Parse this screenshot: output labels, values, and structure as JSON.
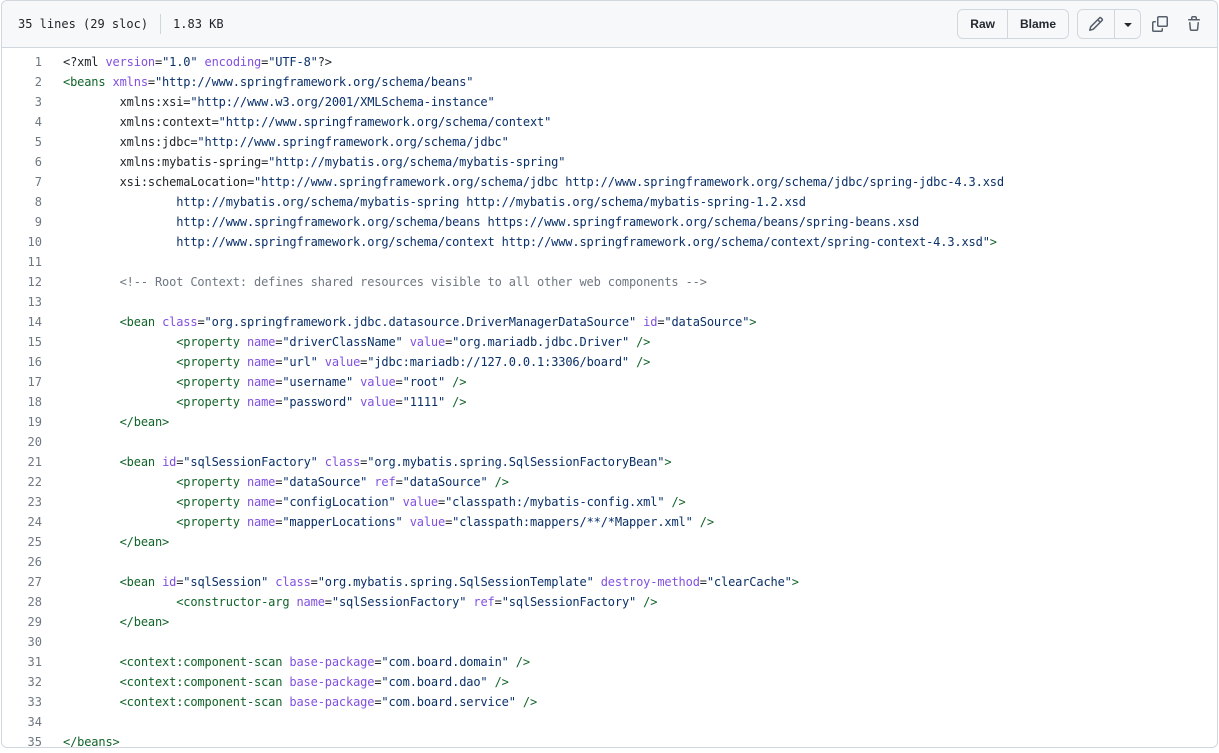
{
  "header": {
    "lines_info": "35 lines (29 sloc)",
    "size_info": "1.83 KB",
    "raw_label": "Raw",
    "blame_label": "Blame"
  },
  "colors": {
    "tag": "#116329",
    "attr": "#8250df",
    "string": "#0a3069",
    "comment": "#6e7781"
  },
  "icons": [
    "pencil-icon",
    "triangle-down-icon",
    "copy-icon",
    "trash-icon"
  ],
  "code_lines": [
    [
      [
        "pi",
        "<?xml "
      ],
      [
        "attr",
        "version"
      ],
      [
        "pi",
        "="
      ],
      [
        "str",
        "\"1.0\""
      ],
      [
        "pi",
        " "
      ],
      [
        "attr",
        "encoding"
      ],
      [
        "pi",
        "="
      ],
      [
        "str",
        "\"UTF-8\""
      ],
      [
        "pi",
        "?>"
      ]
    ],
    [
      [
        "tag",
        "<beans "
      ],
      [
        "attr",
        "xmlns"
      ],
      [
        "pi",
        "="
      ],
      [
        "str",
        "\"http://www.springframework.org/schema/beans\""
      ]
    ],
    [
      [
        "pi",
        "        xmlns:xsi="
      ],
      [
        "str",
        "\"http://www.w3.org/2001/XMLSchema-instance\""
      ]
    ],
    [
      [
        "pi",
        "        xmlns:context="
      ],
      [
        "str",
        "\"http://www.springframework.org/schema/context\""
      ]
    ],
    [
      [
        "pi",
        "        xmlns:jdbc="
      ],
      [
        "str",
        "\"http://www.springframework.org/schema/jdbc\""
      ]
    ],
    [
      [
        "pi",
        "        xmlns:mybatis-spring="
      ],
      [
        "str",
        "\"http://mybatis.org/schema/mybatis-spring\""
      ]
    ],
    [
      [
        "pi",
        "        xsi:schemaLocation="
      ],
      [
        "str",
        "\"http://www.springframework.org/schema/jdbc http://www.springframework.org/schema/jdbc/spring-jdbc-4.3.xsd"
      ]
    ],
    [
      [
        "str",
        "                http://mybatis.org/schema/mybatis-spring http://mybatis.org/schema/mybatis-spring-1.2.xsd"
      ]
    ],
    [
      [
        "str",
        "                http://www.springframework.org/schema/beans https://www.springframework.org/schema/beans/spring-beans.xsd"
      ]
    ],
    [
      [
        "str",
        "                http://www.springframework.org/schema/context http://www.springframework.org/schema/context/spring-context-4.3.xsd\""
      ],
      [
        "tag",
        ">"
      ]
    ],
    [],
    [
      [
        "pi",
        "        "
      ],
      [
        "com",
        "<!-- Root Context: defines shared resources visible to all other web components -->"
      ]
    ],
    [],
    [
      [
        "pi",
        "        "
      ],
      [
        "tag",
        "<bean "
      ],
      [
        "attr",
        "class"
      ],
      [
        "pi",
        "="
      ],
      [
        "str",
        "\"org.springframework.jdbc.datasource.DriverManagerDataSource\""
      ],
      [
        "pi",
        " "
      ],
      [
        "attr",
        "id"
      ],
      [
        "pi",
        "="
      ],
      [
        "str",
        "\"dataSource\""
      ],
      [
        "tag",
        ">"
      ]
    ],
    [
      [
        "pi",
        "                "
      ],
      [
        "tag",
        "<property "
      ],
      [
        "attr",
        "name"
      ],
      [
        "pi",
        "="
      ],
      [
        "str",
        "\"driverClassName\""
      ],
      [
        "pi",
        " "
      ],
      [
        "attr",
        "value"
      ],
      [
        "pi",
        "="
      ],
      [
        "str",
        "\"org.mariadb.jdbc.Driver\""
      ],
      [
        "tag",
        " />"
      ]
    ],
    [
      [
        "pi",
        "                "
      ],
      [
        "tag",
        "<property "
      ],
      [
        "attr",
        "name"
      ],
      [
        "pi",
        "="
      ],
      [
        "str",
        "\"url\""
      ],
      [
        "pi",
        " "
      ],
      [
        "attr",
        "value"
      ],
      [
        "pi",
        "="
      ],
      [
        "str",
        "\"jdbc:mariadb://127.0.0.1:3306/board\""
      ],
      [
        "tag",
        " />"
      ]
    ],
    [
      [
        "pi",
        "                "
      ],
      [
        "tag",
        "<property "
      ],
      [
        "attr",
        "name"
      ],
      [
        "pi",
        "="
      ],
      [
        "str",
        "\"username\""
      ],
      [
        "pi",
        " "
      ],
      [
        "attr",
        "value"
      ],
      [
        "pi",
        "="
      ],
      [
        "str",
        "\"root\""
      ],
      [
        "tag",
        " />"
      ]
    ],
    [
      [
        "pi",
        "                "
      ],
      [
        "tag",
        "<property "
      ],
      [
        "attr",
        "name"
      ],
      [
        "pi",
        "="
      ],
      [
        "str",
        "\"password\""
      ],
      [
        "pi",
        " "
      ],
      [
        "attr",
        "value"
      ],
      [
        "pi",
        "="
      ],
      [
        "str",
        "\"1111\""
      ],
      [
        "tag",
        " />"
      ]
    ],
    [
      [
        "pi",
        "        "
      ],
      [
        "tag",
        "</bean>"
      ]
    ],
    [],
    [
      [
        "pi",
        "        "
      ],
      [
        "tag",
        "<bean "
      ],
      [
        "attr",
        "id"
      ],
      [
        "pi",
        "="
      ],
      [
        "str",
        "\"sqlSessionFactory\""
      ],
      [
        "pi",
        " "
      ],
      [
        "attr",
        "class"
      ],
      [
        "pi",
        "="
      ],
      [
        "str",
        "\"org.mybatis.spring.SqlSessionFactoryBean\""
      ],
      [
        "tag",
        ">"
      ]
    ],
    [
      [
        "pi",
        "                "
      ],
      [
        "tag",
        "<property "
      ],
      [
        "attr",
        "name"
      ],
      [
        "pi",
        "="
      ],
      [
        "str",
        "\"dataSource\""
      ],
      [
        "pi",
        " "
      ],
      [
        "attr",
        "ref"
      ],
      [
        "pi",
        "="
      ],
      [
        "str",
        "\"dataSource\""
      ],
      [
        "tag",
        " />"
      ]
    ],
    [
      [
        "pi",
        "                "
      ],
      [
        "tag",
        "<property "
      ],
      [
        "attr",
        "name"
      ],
      [
        "pi",
        "="
      ],
      [
        "str",
        "\"configLocation\""
      ],
      [
        "pi",
        " "
      ],
      [
        "attr",
        "value"
      ],
      [
        "pi",
        "="
      ],
      [
        "str",
        "\"classpath:/mybatis-config.xml\""
      ],
      [
        "tag",
        " />"
      ]
    ],
    [
      [
        "pi",
        "                "
      ],
      [
        "tag",
        "<property "
      ],
      [
        "attr",
        "name"
      ],
      [
        "pi",
        "="
      ],
      [
        "str",
        "\"mapperLocations\""
      ],
      [
        "pi",
        " "
      ],
      [
        "attr",
        "value"
      ],
      [
        "pi",
        "="
      ],
      [
        "str",
        "\"classpath:mappers/**/*Mapper.xml\""
      ],
      [
        "tag",
        " />"
      ]
    ],
    [
      [
        "pi",
        "        "
      ],
      [
        "tag",
        "</bean>"
      ]
    ],
    [],
    [
      [
        "pi",
        "        "
      ],
      [
        "tag",
        "<bean "
      ],
      [
        "attr",
        "id"
      ],
      [
        "pi",
        "="
      ],
      [
        "str",
        "\"sqlSession\""
      ],
      [
        "pi",
        " "
      ],
      [
        "attr",
        "class"
      ],
      [
        "pi",
        "="
      ],
      [
        "str",
        "\"org.mybatis.spring.SqlSessionTemplate\""
      ],
      [
        "pi",
        " "
      ],
      [
        "attr",
        "destroy-method"
      ],
      [
        "pi",
        "="
      ],
      [
        "str",
        "\"clearCache\""
      ],
      [
        "tag",
        ">"
      ]
    ],
    [
      [
        "pi",
        "                "
      ],
      [
        "tag",
        "<constructor-arg "
      ],
      [
        "attr",
        "name"
      ],
      [
        "pi",
        "="
      ],
      [
        "str",
        "\"sqlSessionFactory\""
      ],
      [
        "pi",
        " "
      ],
      [
        "attr",
        "ref"
      ],
      [
        "pi",
        "="
      ],
      [
        "str",
        "\"sqlSessionFactory\""
      ],
      [
        "tag",
        " />"
      ]
    ],
    [
      [
        "pi",
        "        "
      ],
      [
        "tag",
        "</bean>"
      ]
    ],
    [],
    [
      [
        "pi",
        "        "
      ],
      [
        "tag",
        "<context:component-scan "
      ],
      [
        "attr",
        "base-package"
      ],
      [
        "pi",
        "="
      ],
      [
        "str",
        "\"com.board.domain\""
      ],
      [
        "tag",
        " />"
      ]
    ],
    [
      [
        "pi",
        "        "
      ],
      [
        "tag",
        "<context:component-scan "
      ],
      [
        "attr",
        "base-package"
      ],
      [
        "pi",
        "="
      ],
      [
        "str",
        "\"com.board.dao\""
      ],
      [
        "tag",
        " />"
      ]
    ],
    [
      [
        "pi",
        "        "
      ],
      [
        "tag",
        "<context:component-scan "
      ],
      [
        "attr",
        "base-package"
      ],
      [
        "pi",
        "="
      ],
      [
        "str",
        "\"com.board.service\""
      ],
      [
        "tag",
        " />"
      ]
    ],
    [],
    [
      [
        "tag",
        "</beans>"
      ]
    ]
  ]
}
